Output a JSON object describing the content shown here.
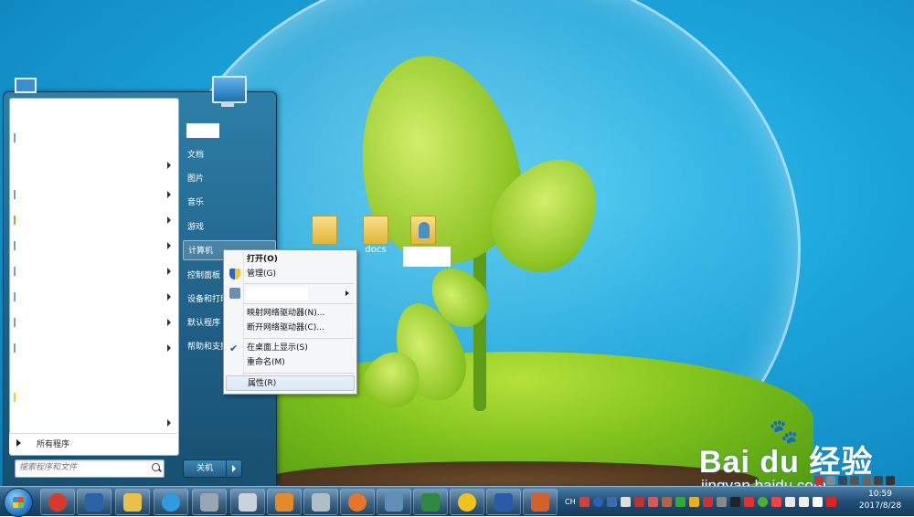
{
  "desktop": {
    "icons": [
      {
        "label": ""
      },
      {
        "label": "docs"
      },
      {
        "label": ""
      }
    ]
  },
  "watermark": {
    "logo": "Bai du 经验",
    "url": "jingyan.baidu.com"
  },
  "start_menu": {
    "all_programs": "所有程序",
    "search_placeholder": "搜索程序和文件",
    "right_items": [
      {
        "label": "文档"
      },
      {
        "label": "图片"
      },
      {
        "label": "音乐"
      },
      {
        "label": "游戏"
      },
      {
        "label": "计算机"
      },
      {
        "label": "控制面板"
      },
      {
        "label": "设备和打印"
      },
      {
        "label": "默认程序"
      },
      {
        "label": "帮助和支持"
      }
    ],
    "shutdown_label": "关机"
  },
  "context_menu": {
    "items": {
      "open": "打开(O)",
      "manage": "管理(G)",
      "map_drive": "映射网络驱动器(N)...",
      "disconnect_drive": "断开网络驱动器(C)...",
      "show_on_desktop": "在桌面上显示(S)",
      "rename": "重命名(M)",
      "properties": "属性(R)"
    }
  },
  "taskbar": {
    "tray_lang": "CH",
    "clock_time": "10:59",
    "clock_date": "2017/8/28"
  },
  "colors": {
    "taskbar": "#1f4e75",
    "start_menu": "#1f5f86",
    "context_menu": "#f5f6f7",
    "desktop": "#1aa3d9"
  }
}
